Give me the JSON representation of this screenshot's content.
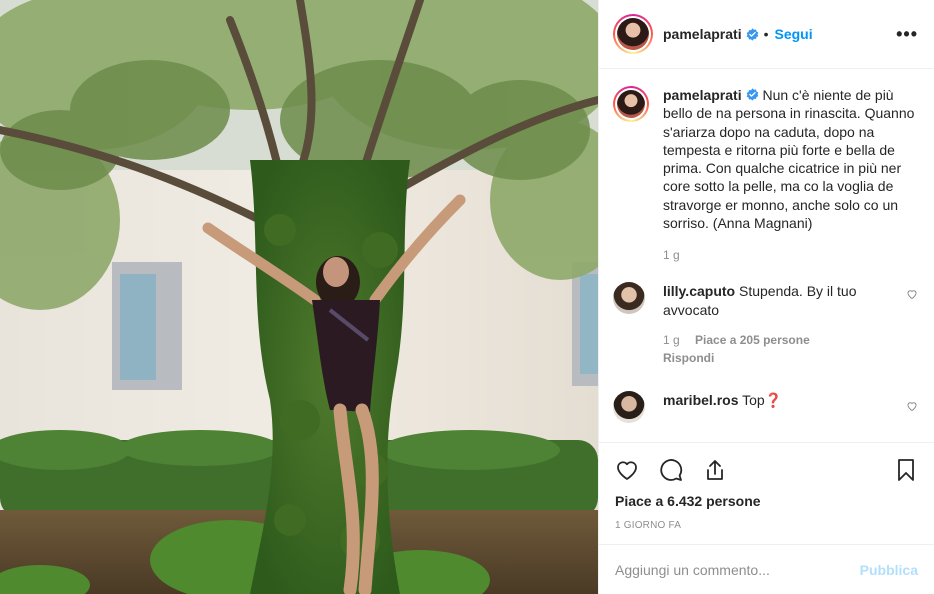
{
  "post": {
    "author": "pamelaprati",
    "follow_label": "Segui",
    "dot": "•",
    "more_label": "•••",
    "caption_author": "pamelaprati",
    "caption": "Nun c'è niente de più bello de na persona in rinascita. Quanno s'ariarza dopo na caduta, dopo na tempesta e ritorna più forte e bella de prima. Con qualche cicatrice in più ner core sotto la pelle, ma co la voglia de stravorge er monno, anche solo co un sorriso. (Anna Magnani)",
    "caption_time": "1 g"
  },
  "comments": [
    {
      "user": "lilly.caputo",
      "text": "Stupenda. By il tuo avvocato",
      "time": "1 g",
      "likes": "Piace a 205 persone",
      "reply": "Rispondi"
    },
    {
      "user": "maribel.ros",
      "text": "Top❓"
    }
  ],
  "actions": {
    "likes": "Piace a 6.432 persone",
    "time": "1 GIORNO FA"
  },
  "add_comment": {
    "placeholder": "Aggiungi un commento...",
    "publish_label": "Pubblica"
  },
  "icons": [
    "verified-badge-icon",
    "heart-icon",
    "comment-icon",
    "share-icon",
    "bookmark-icon",
    "more-icon"
  ],
  "colors": {
    "accent": "#0095f6",
    "publish_disabled": "#b2dffc",
    "muted": "#8e8e8e",
    "text": "#262626"
  }
}
